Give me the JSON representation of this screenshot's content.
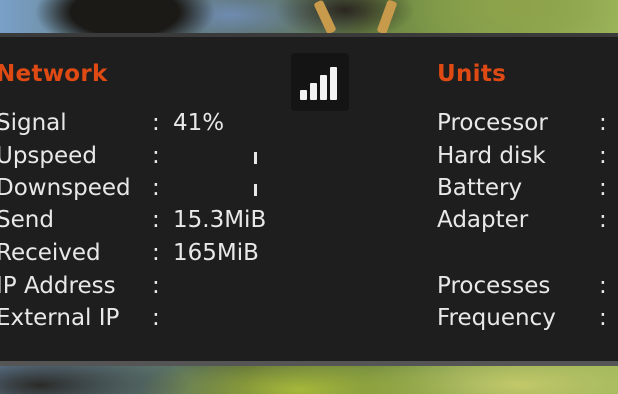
{
  "network": {
    "title": "Network",
    "rows": [
      {
        "label": "Signal",
        "value": "41%"
      },
      {
        "label": "Upspeed",
        "value": ""
      },
      {
        "label": "Downspeed",
        "value": ""
      },
      {
        "label": "Send",
        "value": "15.3MiB"
      },
      {
        "label": "Received",
        "value": "165MiB"
      },
      {
        "label": "IP Address",
        "value": ""
      },
      {
        "label": "External IP",
        "value": ""
      }
    ],
    "separator": ":"
  },
  "signal_icon": "signal-strength-icon",
  "units": {
    "title": "Units",
    "rows": [
      {
        "label": "Processor"
      },
      {
        "label": "Hard disk"
      },
      {
        "label": "Battery"
      },
      {
        "label": "Adapter"
      },
      {
        "label": "Processes"
      },
      {
        "label": "Frequency"
      }
    ],
    "separator": ":"
  },
  "colors": {
    "accent": "#df4a14",
    "panel_bg": "#1e1e1e",
    "text": "#e8e8e8"
  }
}
